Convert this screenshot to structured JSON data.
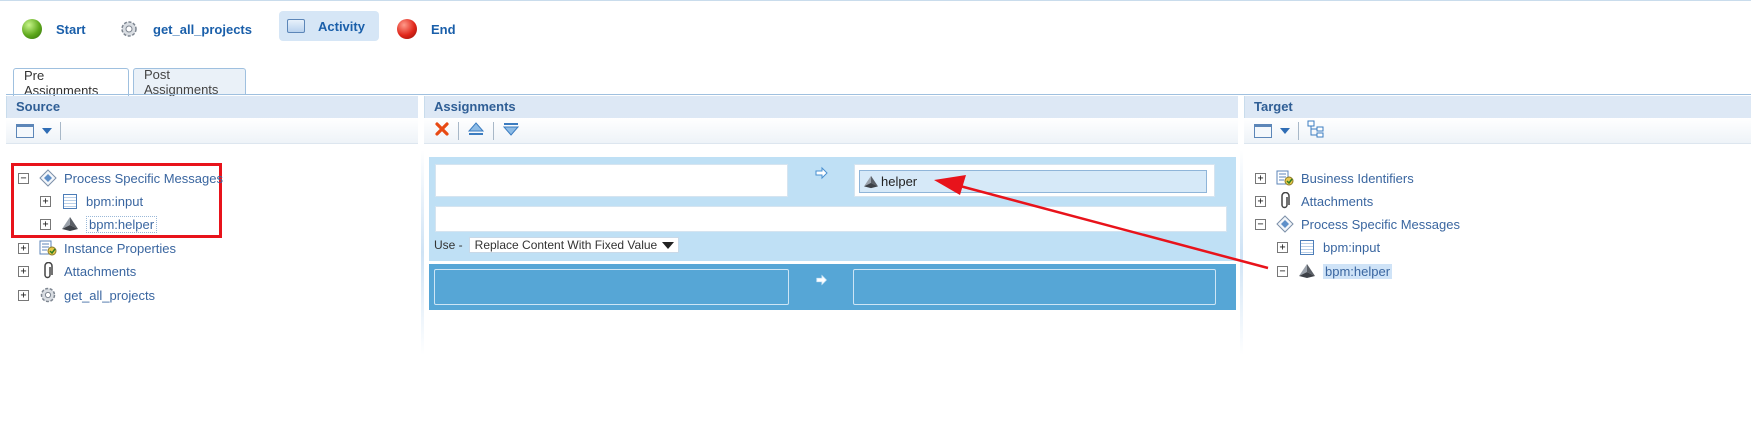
{
  "steps": [
    {
      "label": "Start",
      "icon": "green-ball-icon"
    },
    {
      "label": "get_all_projects",
      "icon": "gear-icon"
    },
    {
      "label": "Activity",
      "icon": "activity-icon"
    },
    {
      "label": "End",
      "icon": "red-ball-icon"
    }
  ],
  "tabs": [
    "Pre Assignments",
    "Post Assignments"
  ],
  "panels": {
    "source": "Source",
    "assignments": "Assignments",
    "target": "Target"
  },
  "source_tree": [
    {
      "label": "Process Specific Messages",
      "toggle": "−",
      "icon": "message-icon"
    },
    {
      "label": "bpm:input",
      "toggle": "+",
      "icon": "document-icon"
    },
    {
      "label": "bpm:helper",
      "toggle": "+",
      "icon": "helper-icon"
    },
    {
      "label": "Instance Properties",
      "toggle": "+",
      "icon": "properties-icon"
    },
    {
      "label": "Attachments",
      "toggle": "+",
      "icon": "paperclip-icon"
    },
    {
      "label": "get_all_projects",
      "toggle": "+",
      "icon": "gear-icon"
    }
  ],
  "target_tree": [
    {
      "label": "Business Identifiers",
      "toggle": "+",
      "icon": "properties-icon"
    },
    {
      "label": "Attachments",
      "toggle": "+",
      "icon": "paperclip-icon"
    },
    {
      "label": "Process Specific Messages",
      "toggle": "−",
      "icon": "message-icon"
    },
    {
      "label": "bpm:input",
      "toggle": "+",
      "icon": "document-icon"
    },
    {
      "label": "bpm:helper",
      "toggle": "−",
      "icon": "helper-icon"
    }
  ],
  "assignment": {
    "target_value": "helper",
    "use_label": "Use -",
    "use_option": "Replace Content With Fixed Value"
  },
  "colors": {
    "accent": "#1a5faa",
    "highlight_box": "#e8131b",
    "assign_light": "#bfe0f5",
    "assign_dark": "#56a6d6",
    "arrow": "#e8131b"
  }
}
